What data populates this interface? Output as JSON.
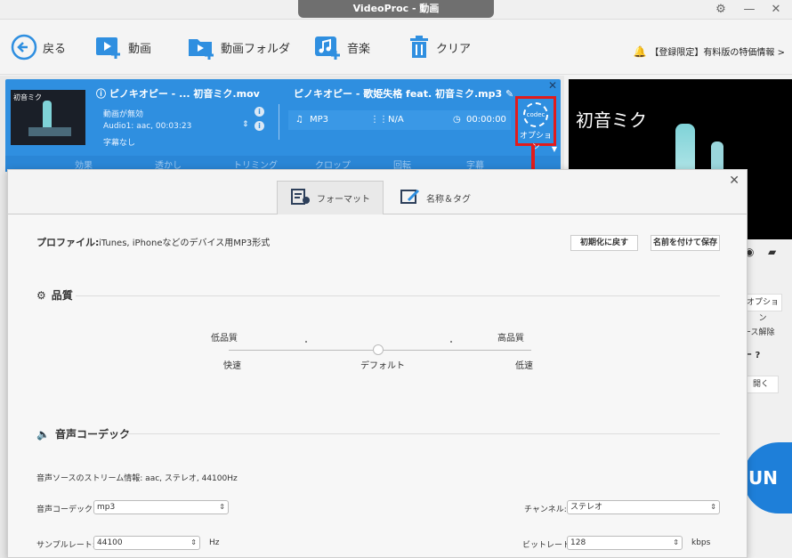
{
  "window": {
    "title": "VideoProc - 動画"
  },
  "toolbar": {
    "back": "戻る",
    "video": "動画",
    "video_folder": "動画フォルダ",
    "music": "音楽",
    "clear": "クリア",
    "notice": "【登録限定】有料版の特価情報 >"
  },
  "task": {
    "thumb_text": "初音ミク",
    "source_title": "ピノキオピー - ... 初音ミク.mov",
    "video_status": "動画が無効",
    "audio_info": "Audio1: aac, 00:03:23",
    "subtitle_info": "字幕なし",
    "output_title": "ピノキオピー - 歌姫失格 feat. 初音ミク.mp3",
    "format": "MP3",
    "resolution": "N/A",
    "duration": "00:00:00",
    "codec_label": "codec",
    "option_label": "オプション",
    "tools": [
      "効果",
      "透かし",
      "トリミング",
      "クロップ",
      "回転",
      "字幕"
    ]
  },
  "preview": {
    "caption": "初音ミク"
  },
  "side": {
    "option": "オプション",
    "release": "ース解除",
    "question": "ー ?",
    "open": "開く",
    "run": "UN"
  },
  "dialog": {
    "tab_format": "フォーマット",
    "tab_name_tag": "名称＆タグ",
    "profile_label": "プロファイル:",
    "profile_value": "iTunes, iPhoneなどのデバイス用MP3形式",
    "reset_button": "初期化に戻す",
    "save_as_button": "名前を付けて保存",
    "quality_title": "品質",
    "low_quality": "低品質",
    "high_quality": "高品質",
    "fast": "快速",
    "default": "デフォルト",
    "slow": "低速",
    "quality_level": 0.5,
    "audio_codec_title": "音声コーデック",
    "stream_info": "音声ソースのストリーム情報: aac, ステレオ, 44100Hz",
    "codec_label": "音声コーデック:",
    "codec_value": "mp3",
    "channel_label": "チャンネル:",
    "channel_value": "ステレオ",
    "samplerate_label": "サンプルレート:",
    "samplerate_value": "44100",
    "samplerate_unit": "Hz",
    "bitrate_label": "ビットレート:",
    "bitrate_value": "128",
    "bitrate_unit": "kbps"
  },
  "colors": {
    "accent": "#2f8fe0",
    "highlight": "#e21b1b"
  }
}
